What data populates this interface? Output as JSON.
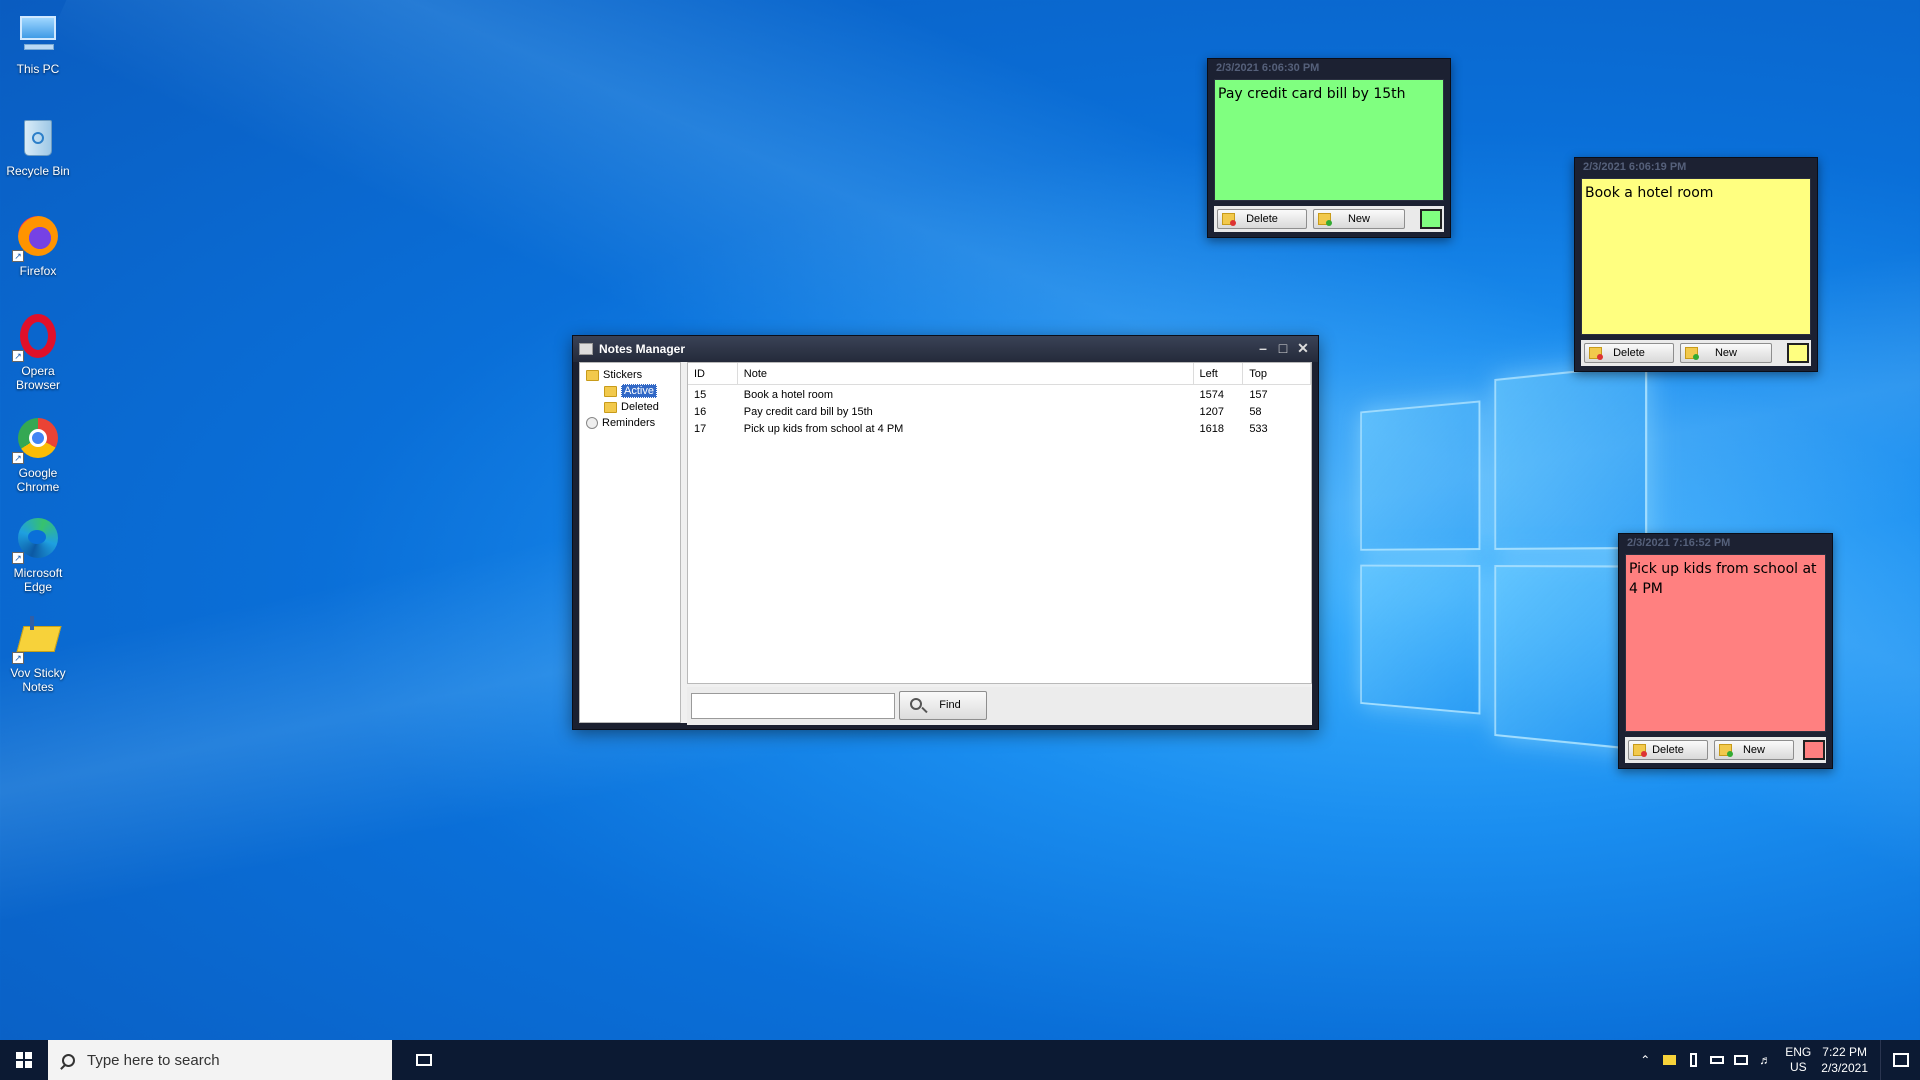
{
  "desktop": {
    "icons": [
      {
        "label": "This PC",
        "icon": "computer-icon"
      },
      {
        "label": "Recycle Bin",
        "icon": "recycle-bin-icon"
      },
      {
        "label": "Firefox",
        "icon": "firefox-icon"
      },
      {
        "label": "Opera Browser",
        "icon": "opera-icon"
      },
      {
        "label": "Google Chrome",
        "icon": "chrome-icon"
      },
      {
        "label": "Microsoft Edge",
        "icon": "edge-icon"
      },
      {
        "label": "Vov Sticky Notes",
        "icon": "sticky-notes-icon"
      }
    ]
  },
  "notes_manager": {
    "title": "Notes Manager",
    "tree": {
      "stickers": "Stickers",
      "active": "Active",
      "deleted": "Deleted",
      "reminders": "Reminders"
    },
    "columns": {
      "id": "ID",
      "note": "Note",
      "left": "Left",
      "top": "Top"
    },
    "rows": [
      {
        "id": "15",
        "note": "Book a hotel room",
        "left": "1574",
        "top": "157"
      },
      {
        "id": "16",
        "note": "Pay credit card bill by 15th",
        "left": "1207",
        "top": "58"
      },
      {
        "id": "17",
        "note": "Pick up kids from school at 4 PM",
        "left": "1618",
        "top": "533"
      }
    ],
    "find_value": "",
    "find_label": "Find"
  },
  "stickies": [
    {
      "timestamp": "2/3/2021 6:06:30 PM",
      "text": "Pay credit card bill by 15th",
      "color": "#80ff80",
      "delete_label": "Delete",
      "new_label": "New"
    },
    {
      "timestamp": "2/3/2021 6:06:19 PM",
      "text": "Book a hotel room",
      "color": "#ffff80",
      "delete_label": "Delete",
      "new_label": "New"
    },
    {
      "timestamp": "2/3/2021 7:16:52 PM",
      "text": "Pick up kids from school at 4 PM",
      "color": "#ff8080",
      "delete_label": "Delete",
      "new_label": "New"
    }
  ],
  "taskbar": {
    "search_placeholder": "Type here to search",
    "lang_line1": "ENG",
    "lang_line2": "US",
    "time": "7:22 PM",
    "date": "2/3/2021"
  },
  "colors": {
    "desktop": "#0a6fd8",
    "selection": "#3168c6"
  }
}
